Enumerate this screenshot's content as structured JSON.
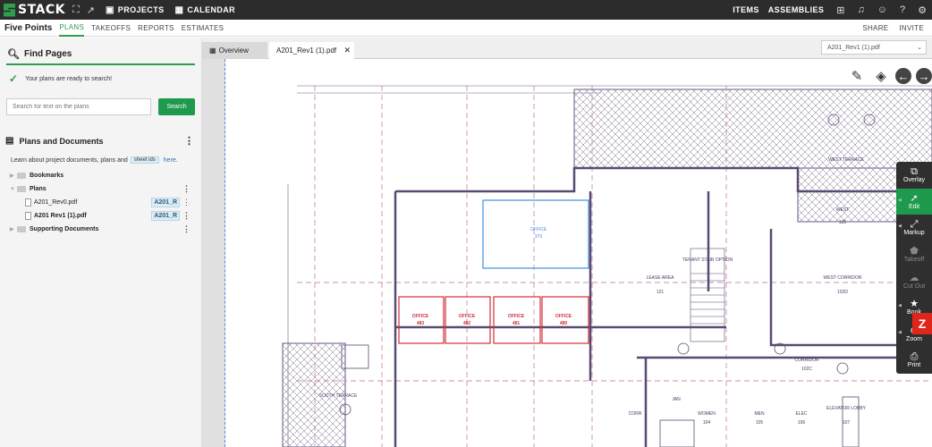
{
  "topbar": {
    "brand": "STACK",
    "projects": "PROJECTS",
    "calendar": "CALENDAR",
    "items": "ITEMS",
    "assemblies": "ASSEMBLIES"
  },
  "navbar": {
    "project_name": "Five Points",
    "tabs": [
      "PLANS",
      "TAKEOFFS",
      "REPORTS",
      "ESTIMATES"
    ],
    "share": "SHARE",
    "invite": "INVITE"
  },
  "left": {
    "find_title": "Find Pages",
    "ready_text": "Your plans are ready to search!",
    "search_placeholder": "Search for text on the plans",
    "search_button": "Search",
    "plans_title": "Plans and Documents",
    "learn_text": "Learn about project documents, plans and",
    "learn_tag": "sheet ids",
    "learn_link": "here.",
    "tree": {
      "bookmarks": "Bookmarks",
      "plans": "Plans",
      "file1": "A201_Rev0.pdf",
      "file1_badge": "A201_R",
      "file2": "A201 Rev1 (1).pdf",
      "file2_badge": "A201_R",
      "supporting": "Supporting Documents"
    }
  },
  "viewer": {
    "tab_overview": "Overview",
    "tab_active": "A201_Rev1 (1).pdf",
    "revision_select": "A201_Rev1 (1).pdf",
    "drawing_labels": {
      "west_terrace": "WEST TERRACE",
      "office": "OFFICE",
      "office_no": "373",
      "lease_area": "LEASE AREA",
      "lease_no": "121",
      "tenant_stair": "TENANT STAIR OPTION",
      "west_corridor": "WEST CORRIDOR",
      "west_corridor_no": "102D",
      "west": "WEST",
      "west_no": "135",
      "office_a": "OFFICE",
      "office_a_no": "483",
      "office_b_no": "482",
      "office_c_no": "481",
      "office_d_no": "480",
      "south_terrace": "SOUTH TERRACE",
      "corridor": "CORRIDOR",
      "corridor_no": "102C",
      "janitor": "JAN",
      "women": "WOMEN",
      "women_no": "104",
      "men": "MEN",
      "men_no": "105",
      "elec": "ELEC",
      "elec_no": "106",
      "elevator_lobby": "ELEVATOR LOBBY",
      "elevator_no": "107",
      "corr": "CORR"
    }
  },
  "tools": {
    "overlay": "Overlay",
    "edit": "Edit",
    "markup": "Markup",
    "takeoff": "Takeoff",
    "cutout": "Cut Out",
    "bookmark": "Book",
    "zoom": "Zoom",
    "print": "Print"
  }
}
